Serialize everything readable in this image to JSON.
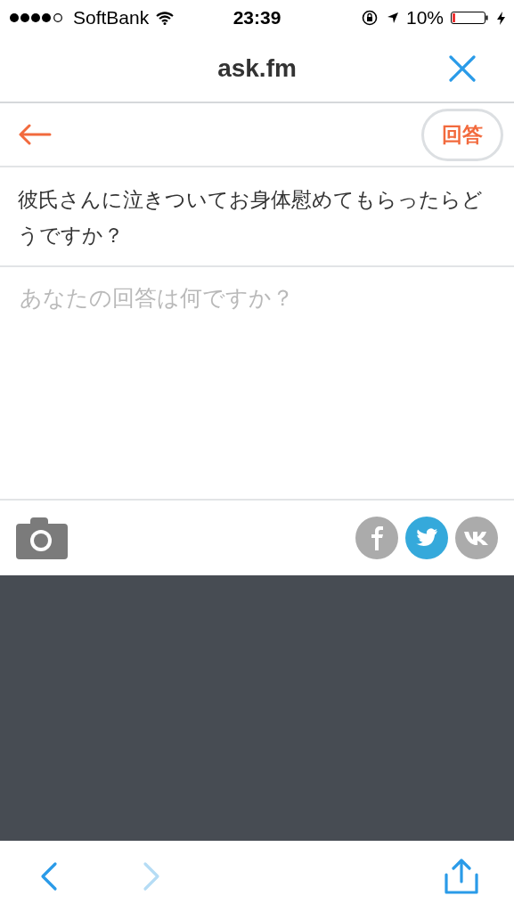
{
  "status_bar": {
    "carrier": "SoftBank",
    "time": "23:39",
    "battery": "10%"
  },
  "header": {
    "title": "ask.fm"
  },
  "toolbar": {
    "submit": "回答"
  },
  "question": {
    "text": "彼氏さんに泣きついてお身体慰めてもらったらどうですか？"
  },
  "answer": {
    "placeholder": "あなたの回答は何ですか？"
  },
  "share": [
    {
      "kind": "facebook",
      "on": false
    },
    {
      "kind": "twitter",
      "on": true
    },
    {
      "kind": "vk",
      "on": false
    }
  ],
  "browser_bar": {
    "back_disabled": false,
    "forward_disabled": true
  }
}
